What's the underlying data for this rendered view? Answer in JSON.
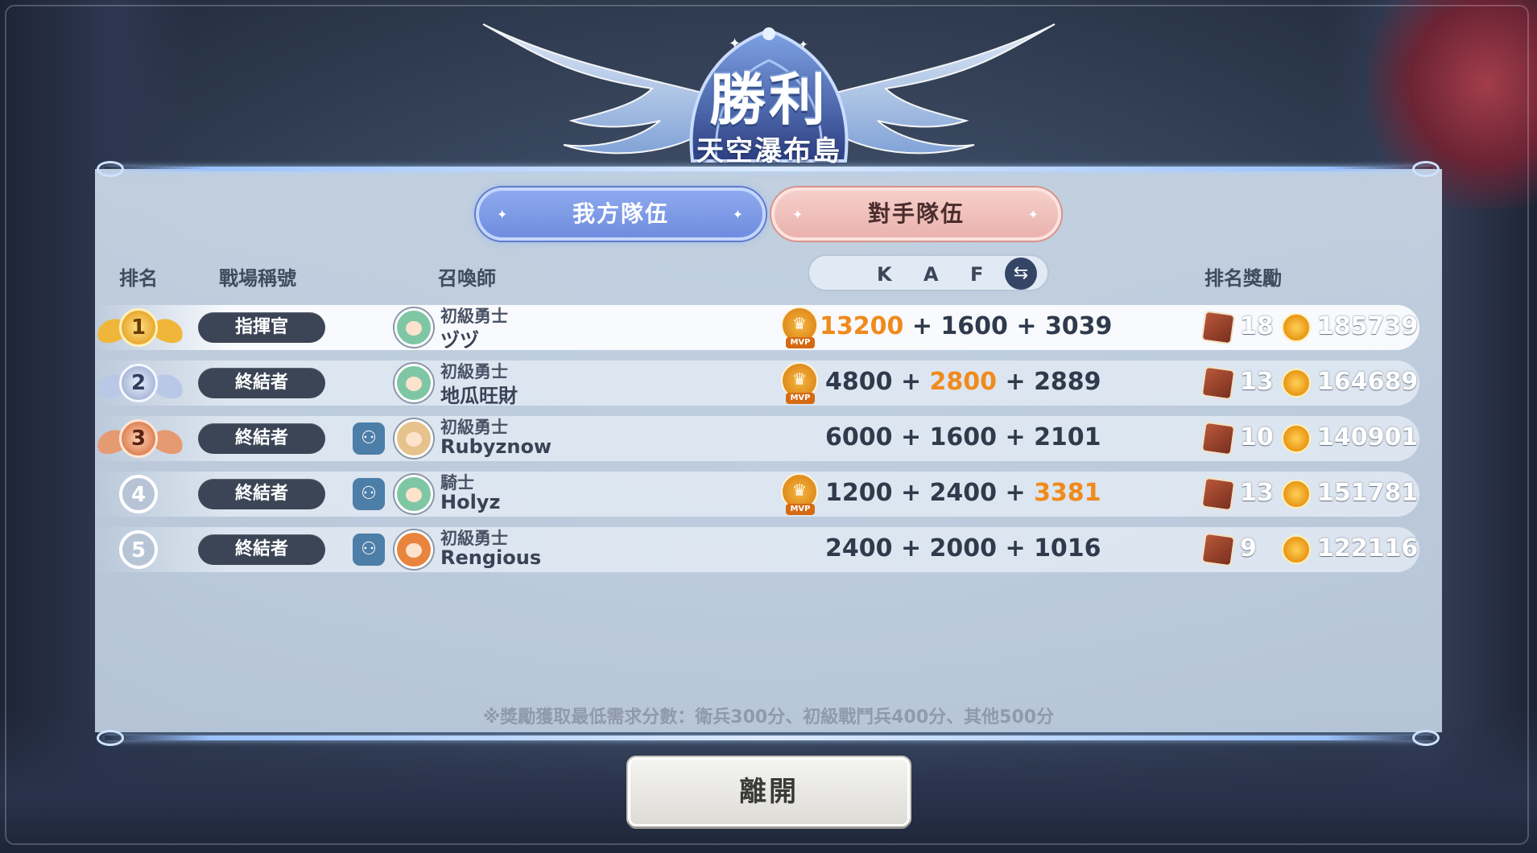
{
  "result": {
    "title": "勝利",
    "map": "天空瀑布島"
  },
  "tabs": {
    "ours": "我方隊伍",
    "theirs": "對手隊伍"
  },
  "headers": {
    "rank": "排名",
    "battle_title": "戰場稱號",
    "summoner": "召喚師",
    "k": "K",
    "a": "A",
    "f": "F",
    "reward": "排名獎勵"
  },
  "players": [
    {
      "rank": "1",
      "title": "指揮官",
      "class": "初級勇士",
      "name": "ヅヅ",
      "k": "13200",
      "a": "1600",
      "f": "3039",
      "highlight": "k",
      "mvp": true,
      "chests": "18",
      "coins": "185739"
    },
    {
      "rank": "2",
      "title": "終結者",
      "class": "初級勇士",
      "name": "地瓜旺財",
      "k": "4800",
      "a": "2800",
      "f": "2889",
      "highlight": "a",
      "mvp": true,
      "chests": "13",
      "coins": "164689"
    },
    {
      "rank": "3",
      "title": "終結者",
      "class": "初級勇士",
      "name": "Rubyznow",
      "k": "6000",
      "a": "1600",
      "f": "2101",
      "highlight": "",
      "mvp": false,
      "chests": "10",
      "coins": "140901"
    },
    {
      "rank": "4",
      "title": "終結者",
      "class": "騎士",
      "name": "Holyz",
      "k": "1200",
      "a": "2400",
      "f": "3381",
      "highlight": "f",
      "mvp": true,
      "chests": "13",
      "coins": "151781"
    },
    {
      "rank": "5",
      "title": "終結者",
      "class": "初級勇士",
      "name": "Rengious",
      "k": "2400",
      "a": "2000",
      "f": "1016",
      "highlight": "",
      "mvp": false,
      "chests": "9",
      "coins": "122116"
    }
  ],
  "mvp_label": "MVP",
  "note": "※獎勵獲取最低需求分數：衛兵300分、初級戰鬥兵400分、其他500分",
  "leave_button": "離開",
  "colors": {
    "highlight": "#f08a1c",
    "tab_ours": "#7f9be6",
    "tab_theirs": "#f0c0bb"
  }
}
